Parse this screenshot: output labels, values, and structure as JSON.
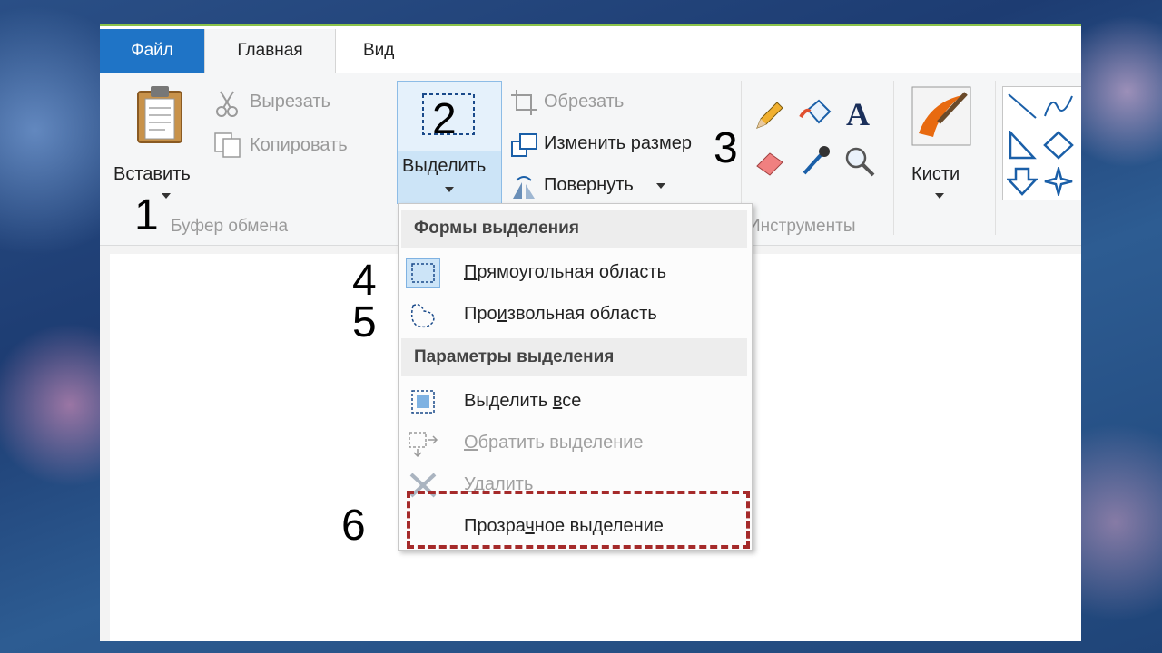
{
  "tabs": {
    "file": "Файл",
    "home": "Главная",
    "view": "Вид"
  },
  "clipboard": {
    "paste": "Вставить",
    "cut": "Вырезать",
    "copy": "Копировать",
    "group": "Буфер обмена"
  },
  "image": {
    "select": "Выделить",
    "crop": "Обрезать",
    "resize": "Изменить размер",
    "rotate": "Повернуть"
  },
  "tools": {
    "group": "Инструменты"
  },
  "brushes": {
    "label": "Кисти"
  },
  "dropdown": {
    "shapes_header": "Формы выделения",
    "rect": [
      "",
      "П",
      "рямоугольная область"
    ],
    "free": [
      "Про",
      "и",
      "звольная область"
    ],
    "options_header": "Параметры выделения",
    "select_all": [
      "Выделить ",
      "в",
      "се"
    ],
    "invert": [
      "",
      "О",
      "братить выделение"
    ],
    "delete": [
      "",
      "У",
      "далить"
    ],
    "transparent": [
      "Прозра",
      "ч",
      "ное выделение"
    ]
  },
  "annotations": [
    "1",
    "2",
    "3",
    "4",
    "5",
    "6"
  ],
  "colors": {
    "file_tab": "#1f74c6",
    "accent_border": "#8bc34a",
    "highlight": "#a52a2a"
  }
}
